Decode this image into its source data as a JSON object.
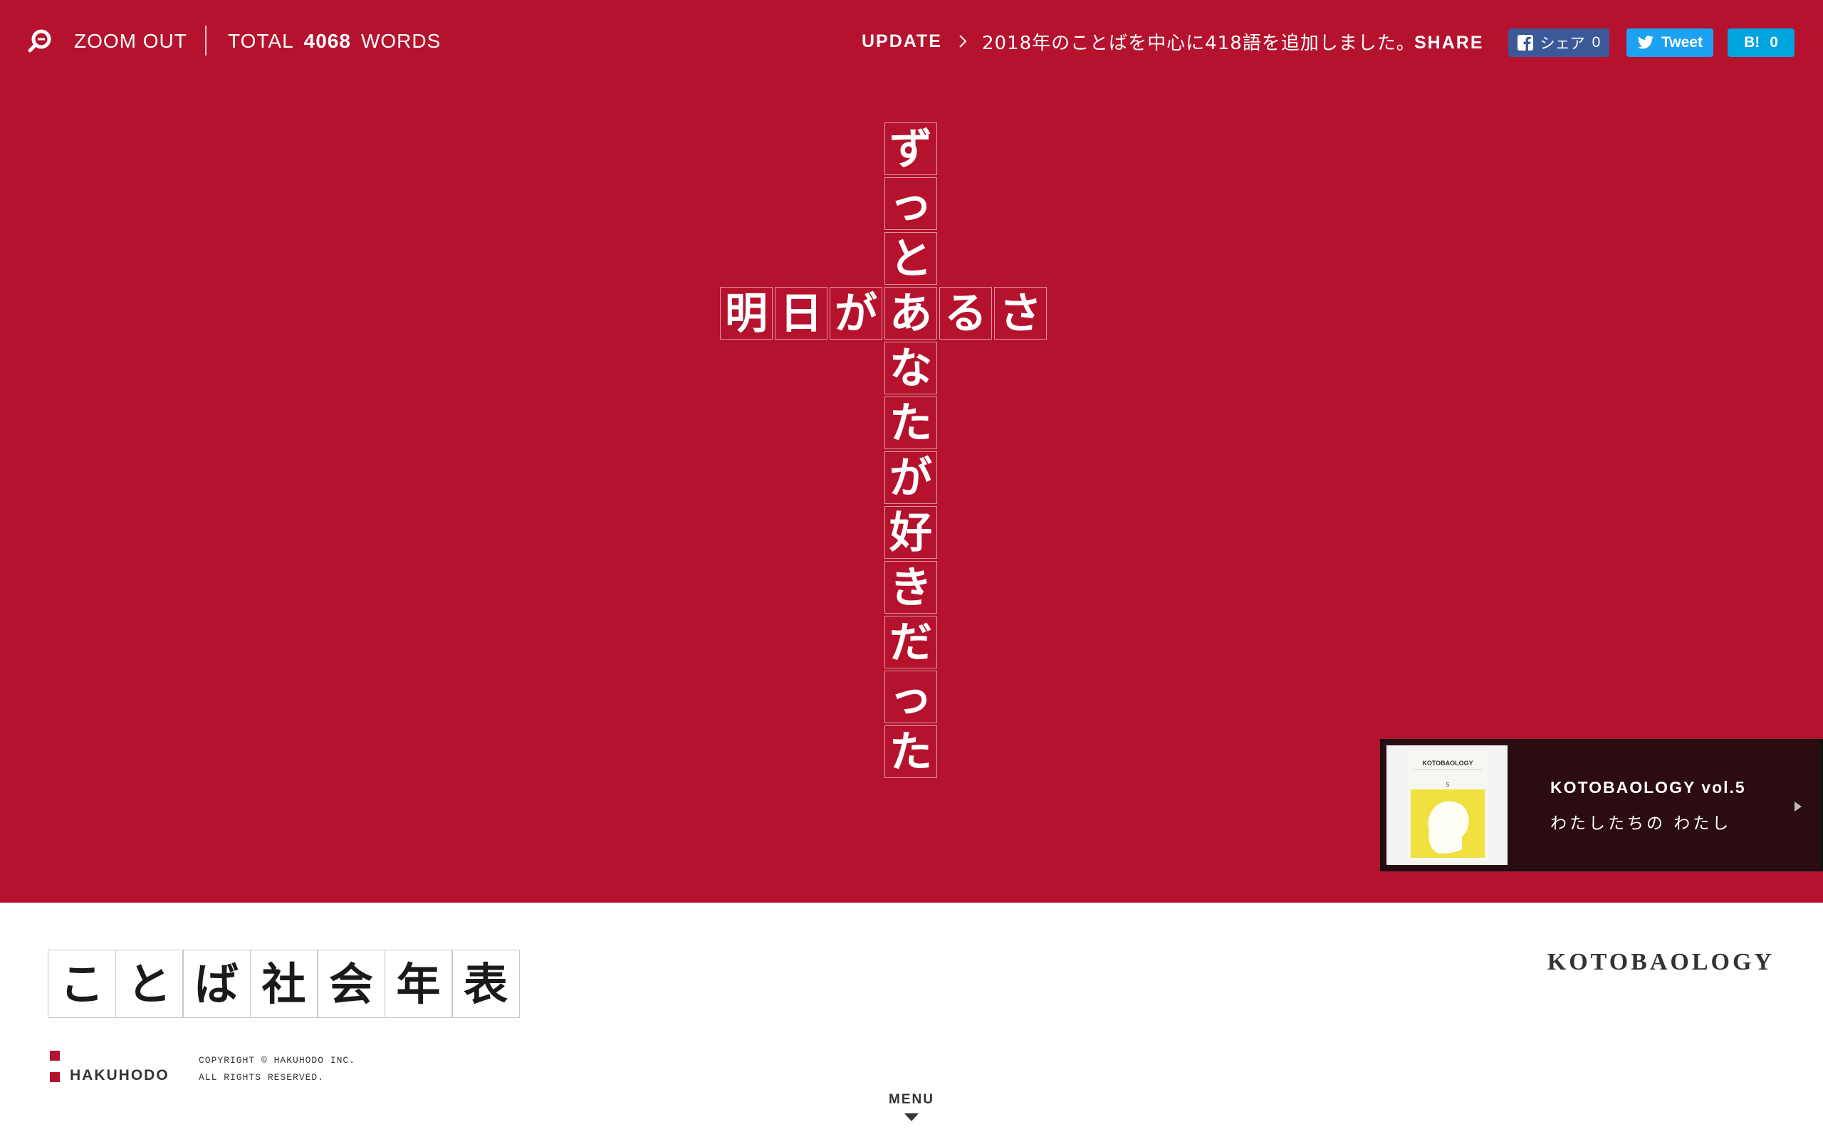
{
  "header": {
    "zoom_out_label": "ZOOM OUT",
    "total_prefix": "TOTAL",
    "total_count": "4068",
    "total_suffix": "WORDS",
    "update_label": "UPDATE",
    "update_text": "2018年のことばを中心に418語を追加しました。",
    "share_label": "SHARE",
    "facebook": {
      "label": "シェア",
      "count": "0",
      "color": "#3b5998"
    },
    "twitter": {
      "label": "Tweet",
      "color": "#1da1f2"
    },
    "hatena": {
      "label": "B!",
      "count": "0",
      "color": "#00a4de"
    }
  },
  "crossword": {
    "vertical": [
      "ず",
      "っ",
      "と",
      "あ",
      "な",
      "た",
      "が",
      "好",
      "き",
      "だ",
      "っ",
      "た"
    ],
    "horizontal": [
      "明",
      "日",
      "が",
      "あ",
      "る",
      "さ"
    ]
  },
  "promo": {
    "title": "KOTOBAOLOGY vol.5",
    "subtitle": "わたしたちの わたし",
    "thumb_caption": "KOTOBAOLOGY",
    "thumb_number": "5"
  },
  "footer": {
    "logo_chars": [
      "こ",
      "と",
      "ば",
      "社",
      "会",
      "年",
      "表"
    ],
    "brand": "KOTOBAOLOGY",
    "company": "HAKUHODO",
    "copyright_line1": "COPYRIGHT © HAKUHODO INC.",
    "copyright_line2": "ALL RIGHTS RESERVED.",
    "menu_label": "MENU"
  },
  "colors": {
    "hero_red": "#b5122e",
    "promo_bg": "#2a0c12",
    "thumb_yellow": "#f0e040"
  },
  "icons": {
    "zoom": "search-icon",
    "update": "chevron-right-icon",
    "promo": "play-triangle-icon",
    "menu": "caret-down-icon"
  }
}
